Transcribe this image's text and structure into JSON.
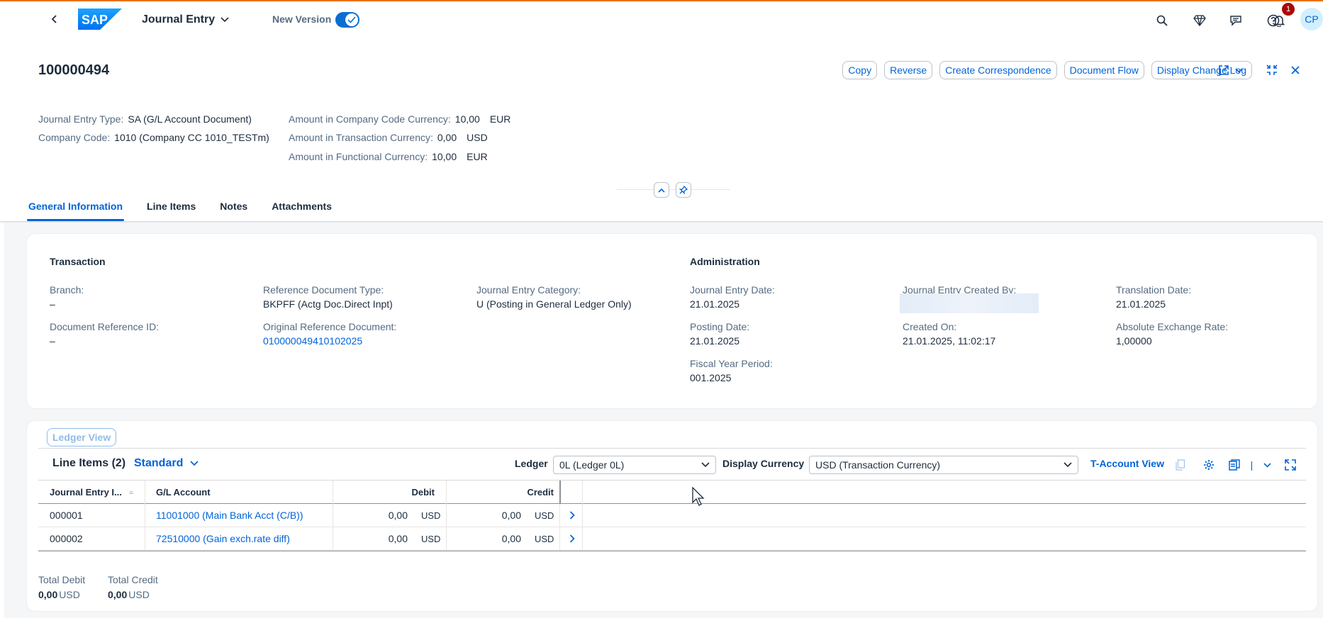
{
  "shell": {
    "app_title": "Journal Entry",
    "new_version_label": "New Version",
    "new_version_on": true,
    "notification_count": "1",
    "avatar_initials": "CP",
    "icons": [
      "search-icon",
      "diamond-icon",
      "chat-icon",
      "help-icon",
      "bell-icon"
    ]
  },
  "header": {
    "doc_id": "100000494",
    "actions": [
      "Copy",
      "Reverse",
      "Create Correspondence",
      "Document Flow",
      "Display Change Log"
    ],
    "attributes_left": [
      {
        "label": "Journal Entry Type:",
        "value": "SA (G/L Account Document)"
      },
      {
        "label": "Company Code:",
        "value": "1010 (Company CC 1010_TESTm)"
      }
    ],
    "attributes_right": [
      {
        "label": "Amount in Company Code Currency:",
        "value": "10,00",
        "currency": "EUR"
      },
      {
        "label": "Amount in Transaction Currency:",
        "value": "0,00",
        "currency": "USD"
      },
      {
        "label": "Amount in Functional Currency:",
        "value": "10,00",
        "currency": "EUR"
      }
    ]
  },
  "tabs": [
    "General Information",
    "Line Items",
    "Notes",
    "Attachments"
  ],
  "active_tab": "General Information",
  "general": {
    "transaction_title": "Transaction",
    "administration_title": "Administration",
    "fields": {
      "branch": {
        "label": "Branch:",
        "value": "–"
      },
      "doc_ref_id": {
        "label": "Document Reference ID:",
        "value": "–"
      },
      "ref_doc_type": {
        "label": "Reference Document Type:",
        "value": "BKPFF (Actg Doc.Direct Inpt)"
      },
      "orig_ref_doc": {
        "label": "Original Reference Document:",
        "value": "010000049410102025"
      },
      "je_category": {
        "label": "Journal Entry Category:",
        "value": "U (Posting in General Ledger Only)"
      },
      "je_date": {
        "label": "Journal Entry Date:",
        "value": "21.01.2025"
      },
      "posting_date": {
        "label": "Posting Date:",
        "value": "21.01.2025"
      },
      "fiscal_period": {
        "label": "Fiscal Year Period:",
        "value": "001.2025"
      },
      "created_by": {
        "label": "Journal Entry Created By:",
        "value": ""
      },
      "created_on": {
        "label": "Created On:",
        "value": "21.01.2025, 11:02:17"
      },
      "translation_date": {
        "label": "Translation Date:",
        "value": "21.01.2025"
      },
      "abs_rate": {
        "label": "Absolute Exchange Rate:",
        "value": "1,00000"
      }
    }
  },
  "line_items": {
    "ledger_view_label": "Ledger View",
    "title": "Line Items (2)",
    "variant": "Standard",
    "ledger_label": "Ledger",
    "ledger_value": "0L (Ledger 0L)",
    "display_currency_label": "Display Currency",
    "display_currency_value": "USD (Transaction Currency)",
    "t_account_label": "T-Account View",
    "columns": [
      "Journal Entry I...",
      "G/L Account",
      "Debit",
      "Credit"
    ],
    "rows": [
      {
        "item": "000001",
        "account": "11001000 (Main Bank Acct (C/B))",
        "debit": "0,00",
        "debit_cur": "USD",
        "credit": "0,00",
        "credit_cur": "USD"
      },
      {
        "item": "000002",
        "account": "72510000 (Gain exch.rate diff)",
        "debit": "0,00",
        "debit_cur": "USD",
        "credit": "0,00",
        "credit_cur": "USD"
      }
    ],
    "totals": {
      "debit_label": "Total Debit",
      "debit_value": "0,00",
      "debit_cur": "USD",
      "credit_label": "Total Credit",
      "credit_value": "0,00",
      "credit_cur": "USD"
    }
  },
  "colors": {
    "accent": "#0064d9",
    "shell_line": "#e9730c",
    "badge": "#aa0808"
  }
}
